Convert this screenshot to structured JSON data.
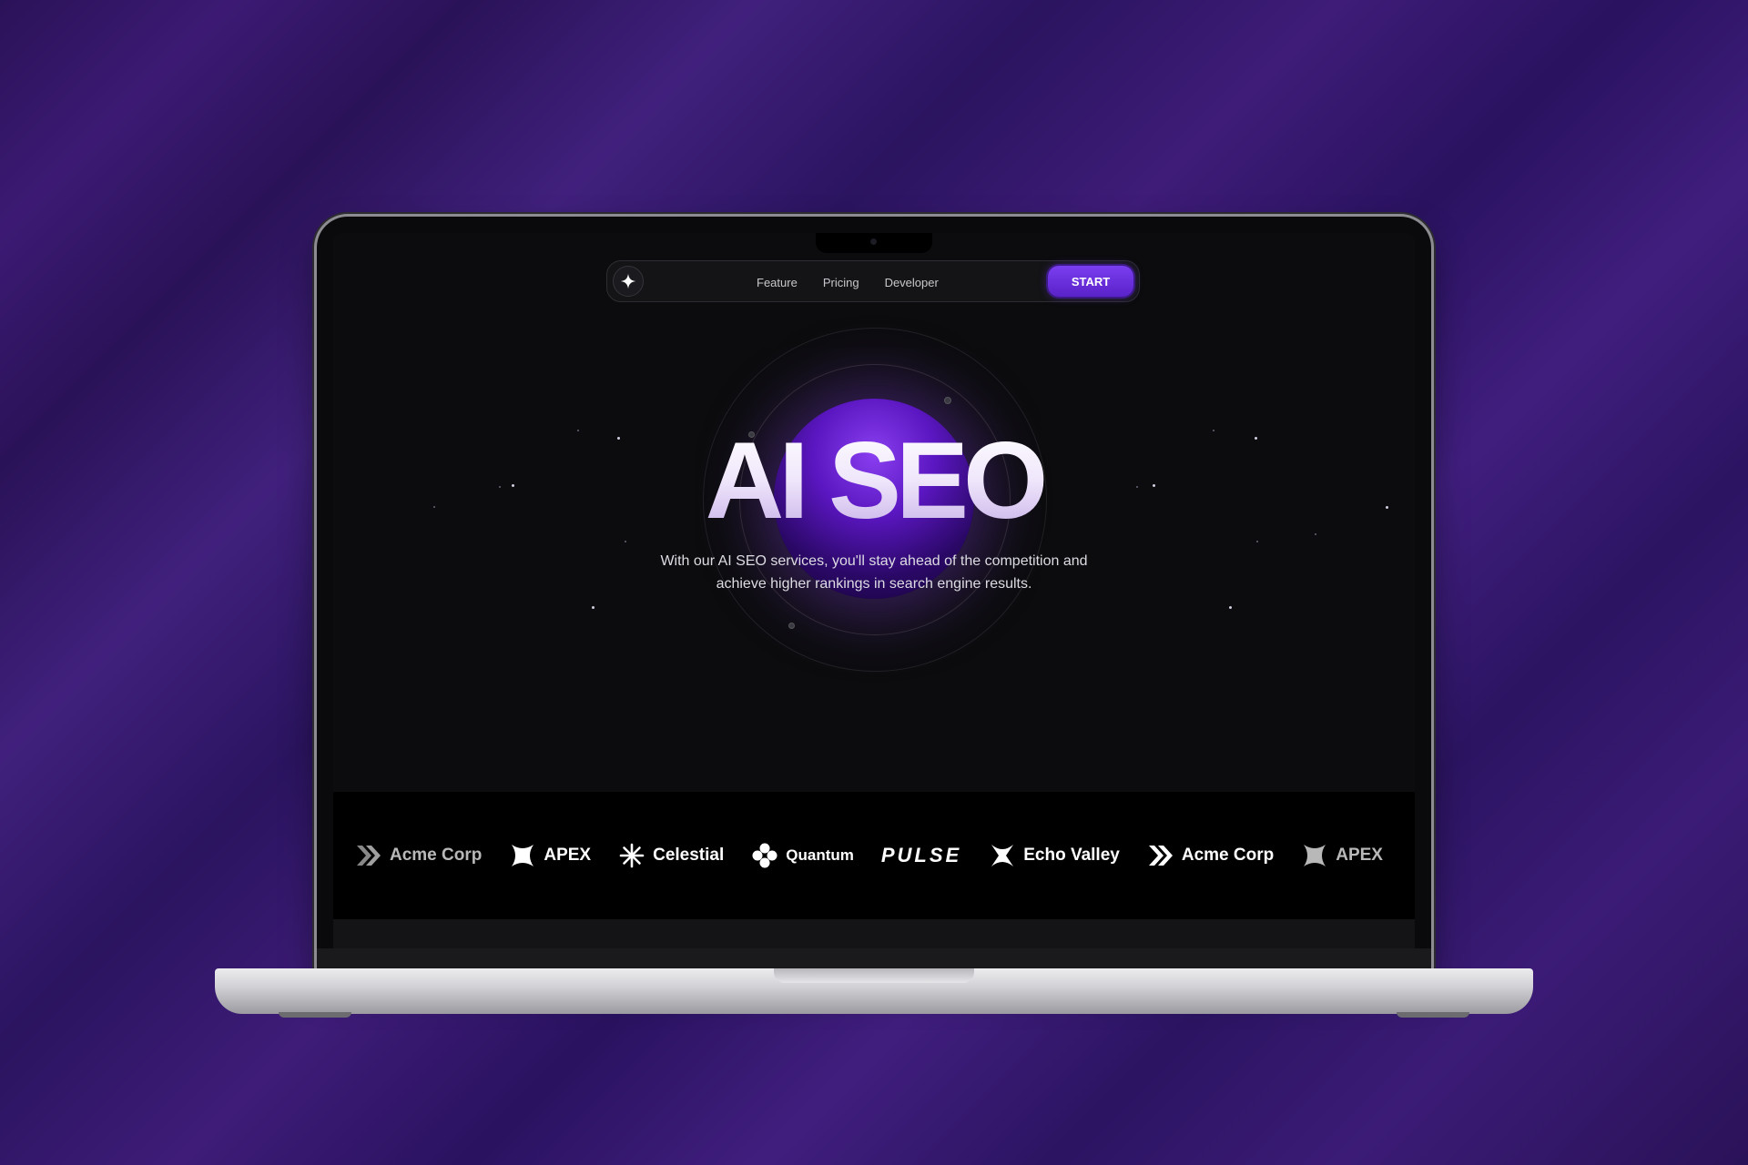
{
  "nav": {
    "links": [
      "Feature",
      "Pricing",
      "Developer"
    ],
    "cta": "START",
    "logo_icon": "sparkle-icon"
  },
  "hero": {
    "title": "AI SEO",
    "subtitle": "With our AI SEO services, you'll stay ahead of the competition and achieve higher rankings in search engine results."
  },
  "logos": [
    {
      "name": "Acme Corp",
      "icon": "chevrons-icon"
    },
    {
      "name": "APEX",
      "icon": "apex-icon"
    },
    {
      "name": "Celestial",
      "icon": "asterisk-icon"
    },
    {
      "name": "Quantum",
      "icon": "clover-icon"
    },
    {
      "name": "PULSE",
      "icon": ""
    },
    {
      "name": "Echo Valley",
      "icon": "x-icon"
    },
    {
      "name": "Acme Corp",
      "icon": "chevrons-icon"
    },
    {
      "name": "APEX",
      "icon": "apex-icon"
    }
  ],
  "colors": {
    "accent": "#6a2fe0",
    "background": "#0c0c0e",
    "wallpaper": "#3a1a72"
  }
}
